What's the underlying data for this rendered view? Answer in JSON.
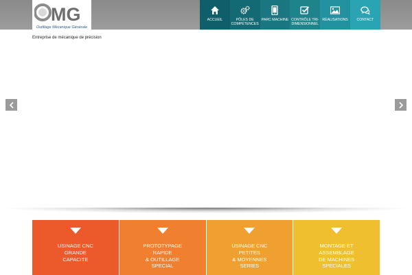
{
  "header": {
    "logo_text": "OMG",
    "logo_subtitle": "Outillage Mécanique Générale",
    "tagline": "Entreprise de mécanique de précision"
  },
  "nav": {
    "items": [
      {
        "label": "ACCUEIL",
        "icon": "home-icon",
        "color": "#0f5f6a"
      },
      {
        "label": "PÔLES DE\nCOMPÉTENCES",
        "icon": "gears-icon",
        "color": "#146a74"
      },
      {
        "label": "PARC MACHINE",
        "icon": "tablet-icon",
        "color": "#1a7680"
      },
      {
        "label": "CONTRÔLE TRI-\nDIMENSIONNEL",
        "icon": "checkbox-icon",
        "color": "#1f838b"
      },
      {
        "label": "RÉALISATIONS",
        "icon": "image-icon",
        "color": "#2392a0"
      },
      {
        "label": "CONTACT",
        "icon": "chat-icon",
        "color": "#2aa3b3"
      }
    ]
  },
  "slider": {
    "prev_icon": "chevron-left-icon",
    "next_icon": "chevron-right-icon"
  },
  "cards": [
    {
      "label": "USINAGE CNC\nGRANDE\nCAPACITE",
      "color": "#ec5a2c"
    },
    {
      "label": "PROTOTYPAGE\nRAPIDE\n& OUTILLAGE\nSPECIAL",
      "color": "#f08030"
    },
    {
      "label": "USINAGE CNC\nPETITES\n& MOYENNES\nSERIES",
      "color": "#f0a030"
    },
    {
      "label": "MONTAGE ET\nASSEMBLAGE\nDE MACHINES\nSPECIALES",
      "color": "#f0bf30"
    }
  ]
}
